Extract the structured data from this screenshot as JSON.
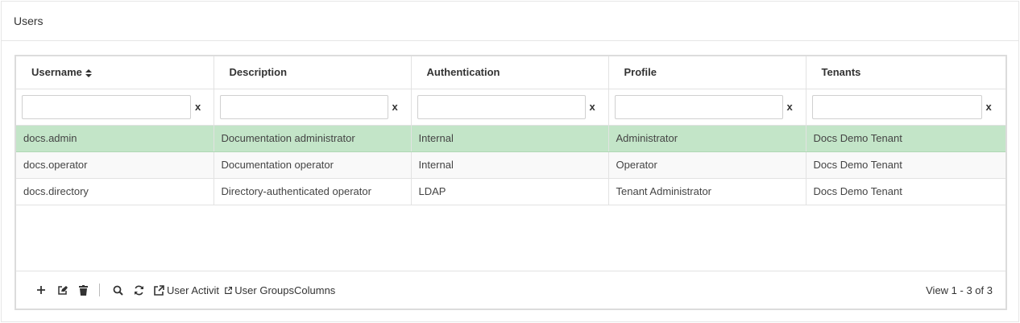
{
  "panel": {
    "title": "Users"
  },
  "columns": [
    {
      "label": "Username",
      "sorted": "ascending"
    },
    {
      "label": "Description"
    },
    {
      "label": "Authentication"
    },
    {
      "label": "Profile"
    },
    {
      "label": "Tenants"
    }
  ],
  "filters": {
    "clear_label": "x"
  },
  "rows": [
    {
      "username": "docs.admin",
      "description": "Documentation administrator",
      "authentication": "Internal",
      "profile": "Administrator",
      "tenants": "Docs Demo Tenant",
      "selected": true
    },
    {
      "username": "docs.operator",
      "description": "Documentation operator",
      "authentication": "Internal",
      "profile": "Operator",
      "tenants": "Docs Demo Tenant",
      "selected": false
    },
    {
      "username": "docs.directory",
      "description": "Directory-authenticated operator",
      "authentication": "LDAP",
      "profile": "Tenant Administrator",
      "tenants": "Docs Demo Tenant",
      "selected": false
    }
  ],
  "toolbar": {
    "add_icon": "plus-icon",
    "edit_icon": "edit-icon",
    "delete_icon": "trash-icon",
    "search_icon": "search-icon",
    "refresh_icon": "refresh-icon",
    "user_activity_label": "User Activit",
    "user_groups_label": "User Groups",
    "columns_label": "Columns"
  },
  "pager": {
    "info": "View 1 - 3 of 3"
  },
  "colors": {
    "selected_row": "#c3e5c8",
    "border": "#dcdcdc"
  }
}
